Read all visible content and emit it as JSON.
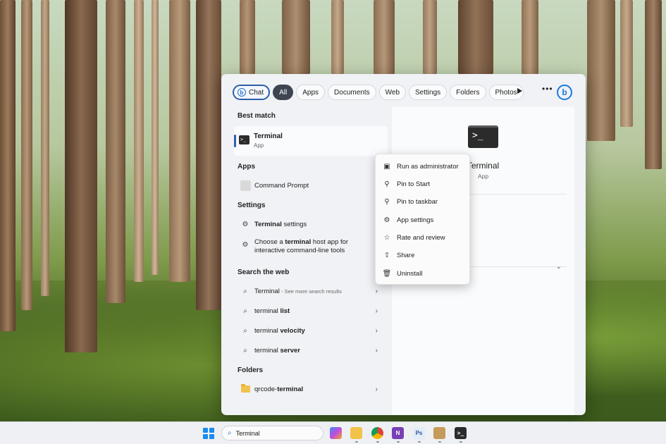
{
  "filters": {
    "chat": "Chat",
    "items": [
      "All",
      "Apps",
      "Documents",
      "Web",
      "Settings",
      "Folders",
      "Photos"
    ],
    "active": "All"
  },
  "best_match": {
    "heading": "Best match",
    "title": "Terminal",
    "subtitle": "App"
  },
  "apps": {
    "heading": "Apps",
    "items": [
      {
        "label": "Command Prompt"
      }
    ]
  },
  "settings": {
    "heading": "Settings",
    "item1_bold": "Terminal",
    "item1_rest": " settings",
    "item2_pre": "Choose a ",
    "item2_bold": "terminal",
    "item2_post": " host app for",
    "item2_line2": "interactive command-line tools"
  },
  "web": {
    "heading": "Search the web",
    "r1_term": "Terminal",
    "r1_hint": " - See more search results",
    "r2_pre": "terminal ",
    "r2_bold": "list",
    "r3_pre": "terminal ",
    "r3_bold": "velocity",
    "r4_pre": "terminal ",
    "r4_bold": "server"
  },
  "folders": {
    "heading": "Folders",
    "item_pre": "qrcode-",
    "item_bold": "terminal"
  },
  "preview": {
    "title": "Terminal",
    "subtitle": "App"
  },
  "context_menu": [
    {
      "label": "Run as administrator",
      "icon": "shield-icon"
    },
    {
      "label": "Pin to Start",
      "icon": "pin-icon"
    },
    {
      "label": "Pin to taskbar",
      "icon": "pin-icon"
    },
    {
      "label": "App settings",
      "icon": "gear-icon"
    },
    {
      "label": "Rate and review",
      "icon": "star-icon"
    },
    {
      "label": "Share",
      "icon": "share-icon"
    },
    {
      "label": "Uninstall",
      "icon": "trash-icon"
    }
  ],
  "taskbar": {
    "search_value": "Terminal",
    "apps": [
      "copilot",
      "file-explorer",
      "chrome",
      "onenote",
      "photoshop",
      "archive",
      "terminal"
    ]
  },
  "colors": {
    "accent": "#2f5fb5",
    "panel_bg": "#f0f2f5"
  }
}
